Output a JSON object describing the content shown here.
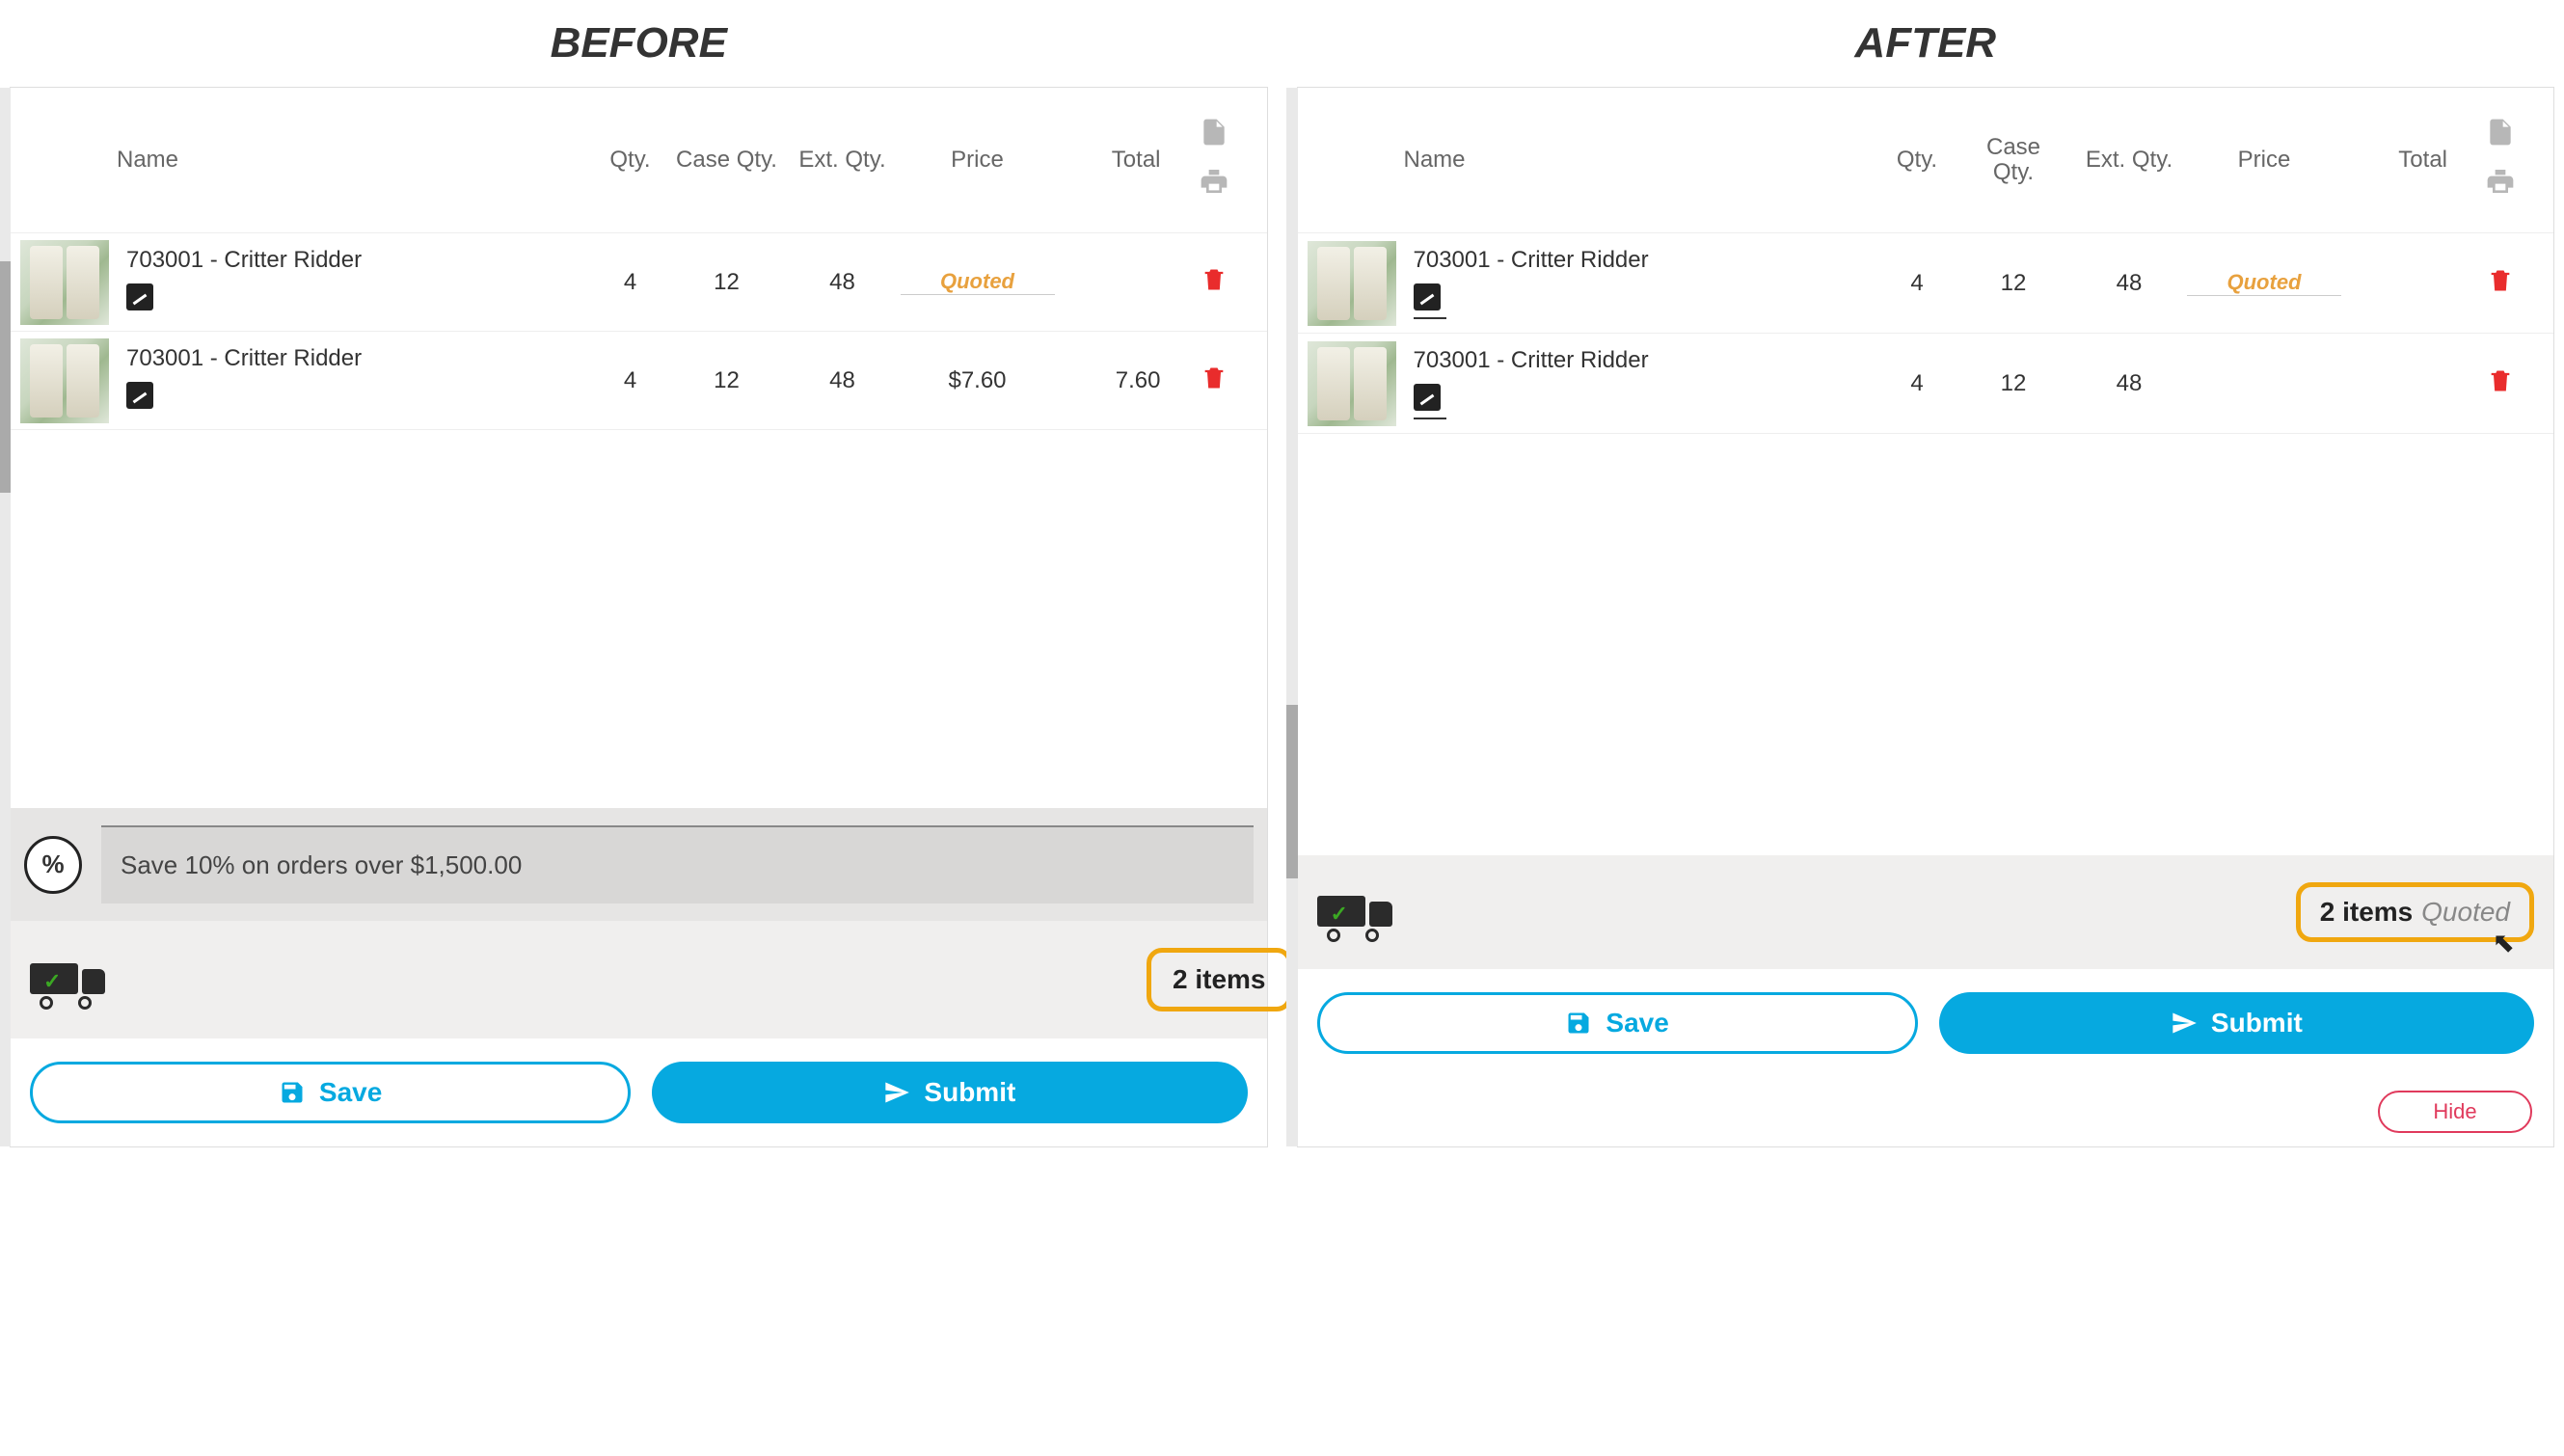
{
  "before": {
    "heading": "BEFORE",
    "headers": {
      "name": "Name",
      "qty": "Qty.",
      "caseQty": "Case Qty.",
      "extQty": "Ext. Qty.",
      "price": "Price",
      "total": "Total"
    },
    "rows": [
      {
        "name": "703001 - Critter Ridder",
        "qty": "4",
        "caseQty": "12",
        "extQty": "48",
        "price": "Quoted",
        "total": "",
        "quoted": true
      },
      {
        "name": "703001 - Critter Ridder",
        "qty": "4",
        "caseQty": "12",
        "extQty": "48",
        "price": "$7.60",
        "total": "7.60",
        "quoted": false
      }
    ],
    "promo": "Save 10% on orders over $1,500.00",
    "summary": {
      "items": "2 items"
    },
    "buttons": {
      "save": "Save",
      "submit": "Submit"
    }
  },
  "after": {
    "heading": "AFTER",
    "headers": {
      "name": "Name",
      "qty": "Qty.",
      "caseQtyL1": "Case",
      "caseQtyL2": "Qty.",
      "extQty": "Ext. Qty.",
      "price": "Price",
      "total": "Total"
    },
    "rows": [
      {
        "name": "703001 - Critter Ridder",
        "qty": "4",
        "caseQty": "12",
        "extQty": "48",
        "price": "Quoted",
        "total": "",
        "quoted": true
      },
      {
        "name": "703001 - Critter Ridder",
        "qty": "4",
        "caseQty": "12",
        "extQty": "48",
        "price": "",
        "total": "",
        "quoted": false
      }
    ],
    "summary": {
      "items": "2 items",
      "status": "Quoted"
    },
    "buttons": {
      "save": "Save",
      "submit": "Submit",
      "hide": "Hide"
    }
  }
}
